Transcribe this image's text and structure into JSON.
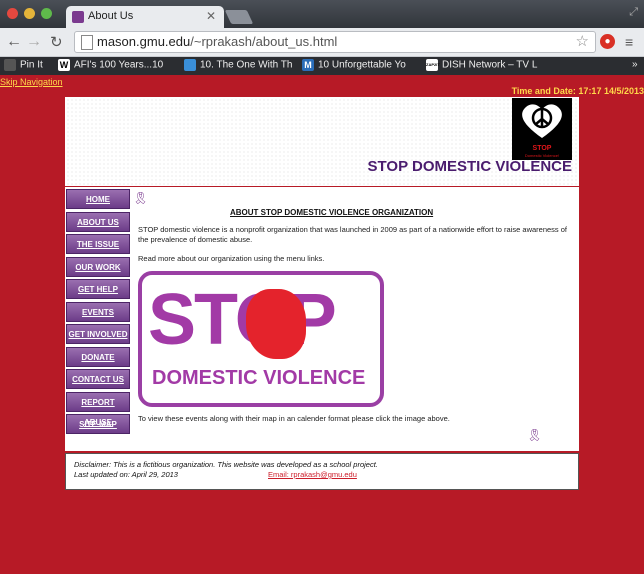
{
  "browser": {
    "tab_title": "About Us",
    "url_host": "mason.gmu.edu",
    "url_path": "/~rprakash/about_us.html",
    "bookmarks": [
      {
        "icon": "",
        "label": "Pin It"
      },
      {
        "icon": "W",
        "label": "AFI's 100 Years...10"
      },
      {
        "icon": "",
        "label": "10. The One With Th"
      },
      {
        "icon": "M",
        "label": "10 Unforgettable Yo"
      },
      {
        "icon": "ZAP2IT",
        "label": "DISH Network – TV L"
      }
    ],
    "overflow": "»"
  },
  "page": {
    "skip_nav": "Skip Navigation",
    "datetime": "Time and Date: 17:17 14/5/2013",
    "logo_text": "STOP",
    "logo_subtext": "Domestic Violence!",
    "site_title": "STOP DOMESTIC VIOLENCE",
    "nav": [
      {
        "label": "HOME"
      },
      {
        "label": "ABOUT US"
      },
      {
        "label": "THE ISSUE"
      },
      {
        "label": "OUR WORK"
      },
      {
        "label": "GET HELP"
      },
      {
        "label": "EVENTS"
      },
      {
        "label": "GET INVOLVED"
      },
      {
        "label": "DONATE"
      },
      {
        "label": "CONTACT US"
      },
      {
        "label": "REPORT ABUSE"
      },
      {
        "label": "SITE MAP"
      }
    ],
    "heading": "ABOUT STOP DOMESTIC VIOLENCE ORGANIZATION",
    "para1": "STOP domestic violence is a nonprofit organization that was launched in 2009 as part of a nationwide effort to raise awareness of the prevalence of domestic abuse.",
    "para2": "Read more about our organization using the menu links.",
    "banner_stop": "STOP",
    "banner_dv": "DOMESTIC VIOLENCE",
    "para3": "To view these events along with their map in an calender format please click the image above.",
    "footer": {
      "disclaimer": "Disclaimer: This is a fictitious organization. This website was developed as a school project.",
      "updated": "Last updated on: April 29, 2013",
      "email": "Email: rprakash@gmu.edu"
    }
  },
  "colors": {
    "background": "#b71a26",
    "purple": "#6c3c88",
    "title": "#4a1c6e"
  }
}
